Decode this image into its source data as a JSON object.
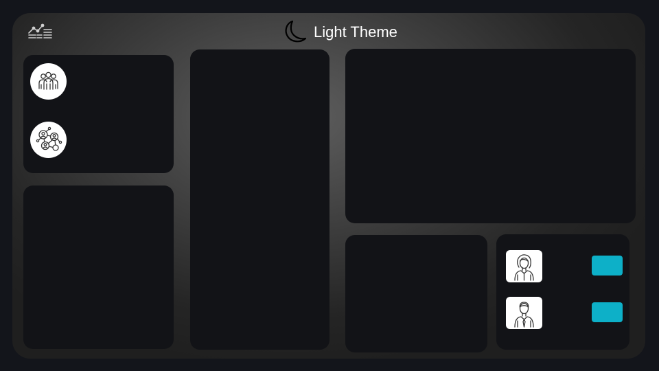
{
  "header": {
    "logo_icon": "line-chart-list-icon",
    "theme_toggle": {
      "icon": "moon-icon",
      "label": "Light Theme"
    }
  },
  "sidebar_top_panel": {
    "items": [
      {
        "icon": "team-icon"
      },
      {
        "icon": "network-people-icon"
      }
    ]
  },
  "people_panel": {
    "people": [
      {
        "avatar": "woman-avatar-icon"
      },
      {
        "avatar": "man-avatar-icon"
      }
    ]
  },
  "colors": {
    "page_background": "#13151b",
    "panel_background": "#121317",
    "accent": "#0db0c8",
    "text": "#ffffff"
  }
}
